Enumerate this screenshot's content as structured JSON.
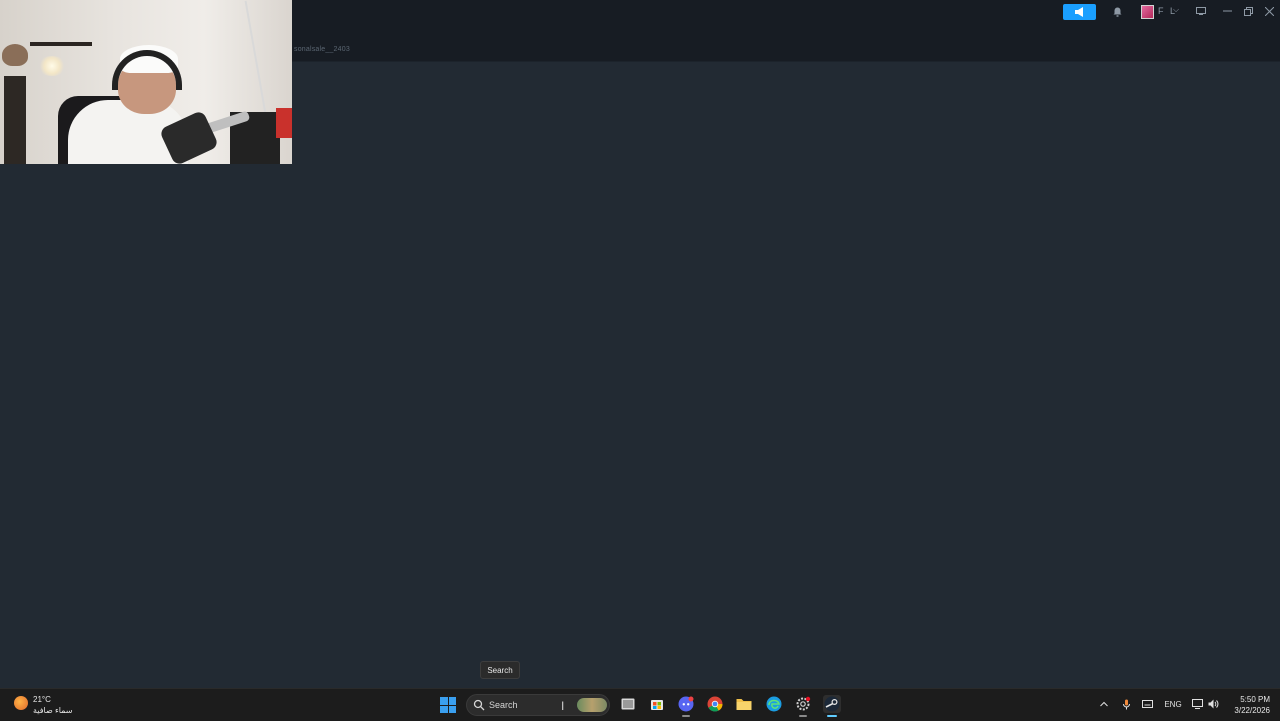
{
  "browser": {
    "url_fragment": "sonalsale__2403",
    "user_name": "F L",
    "user_chevron": "⌵"
  },
  "tooltip": {
    "text": "Search"
  },
  "taskbar": {
    "weather": {
      "temp": "21°C",
      "desc": "سماء صافية"
    },
    "search": {
      "placeholder": "Search"
    },
    "apps": [
      {
        "name": "widgets-app"
      },
      {
        "name": "task-view"
      },
      {
        "name": "microsoft-store"
      },
      {
        "name": "discord"
      },
      {
        "name": "chrome"
      },
      {
        "name": "file-explorer"
      },
      {
        "name": "edge"
      },
      {
        "name": "settings-gear"
      },
      {
        "name": "steam"
      }
    ],
    "tray": {
      "language": "ENG"
    },
    "clock": {
      "time": "5:50 PM",
      "date": "3/22/2026"
    }
  },
  "colors": {
    "app_bg": "#222a33",
    "topbar_bg": "#171c23",
    "accent_blue": "#1a9fff",
    "taskbar_bg": "#1c1c1c"
  }
}
